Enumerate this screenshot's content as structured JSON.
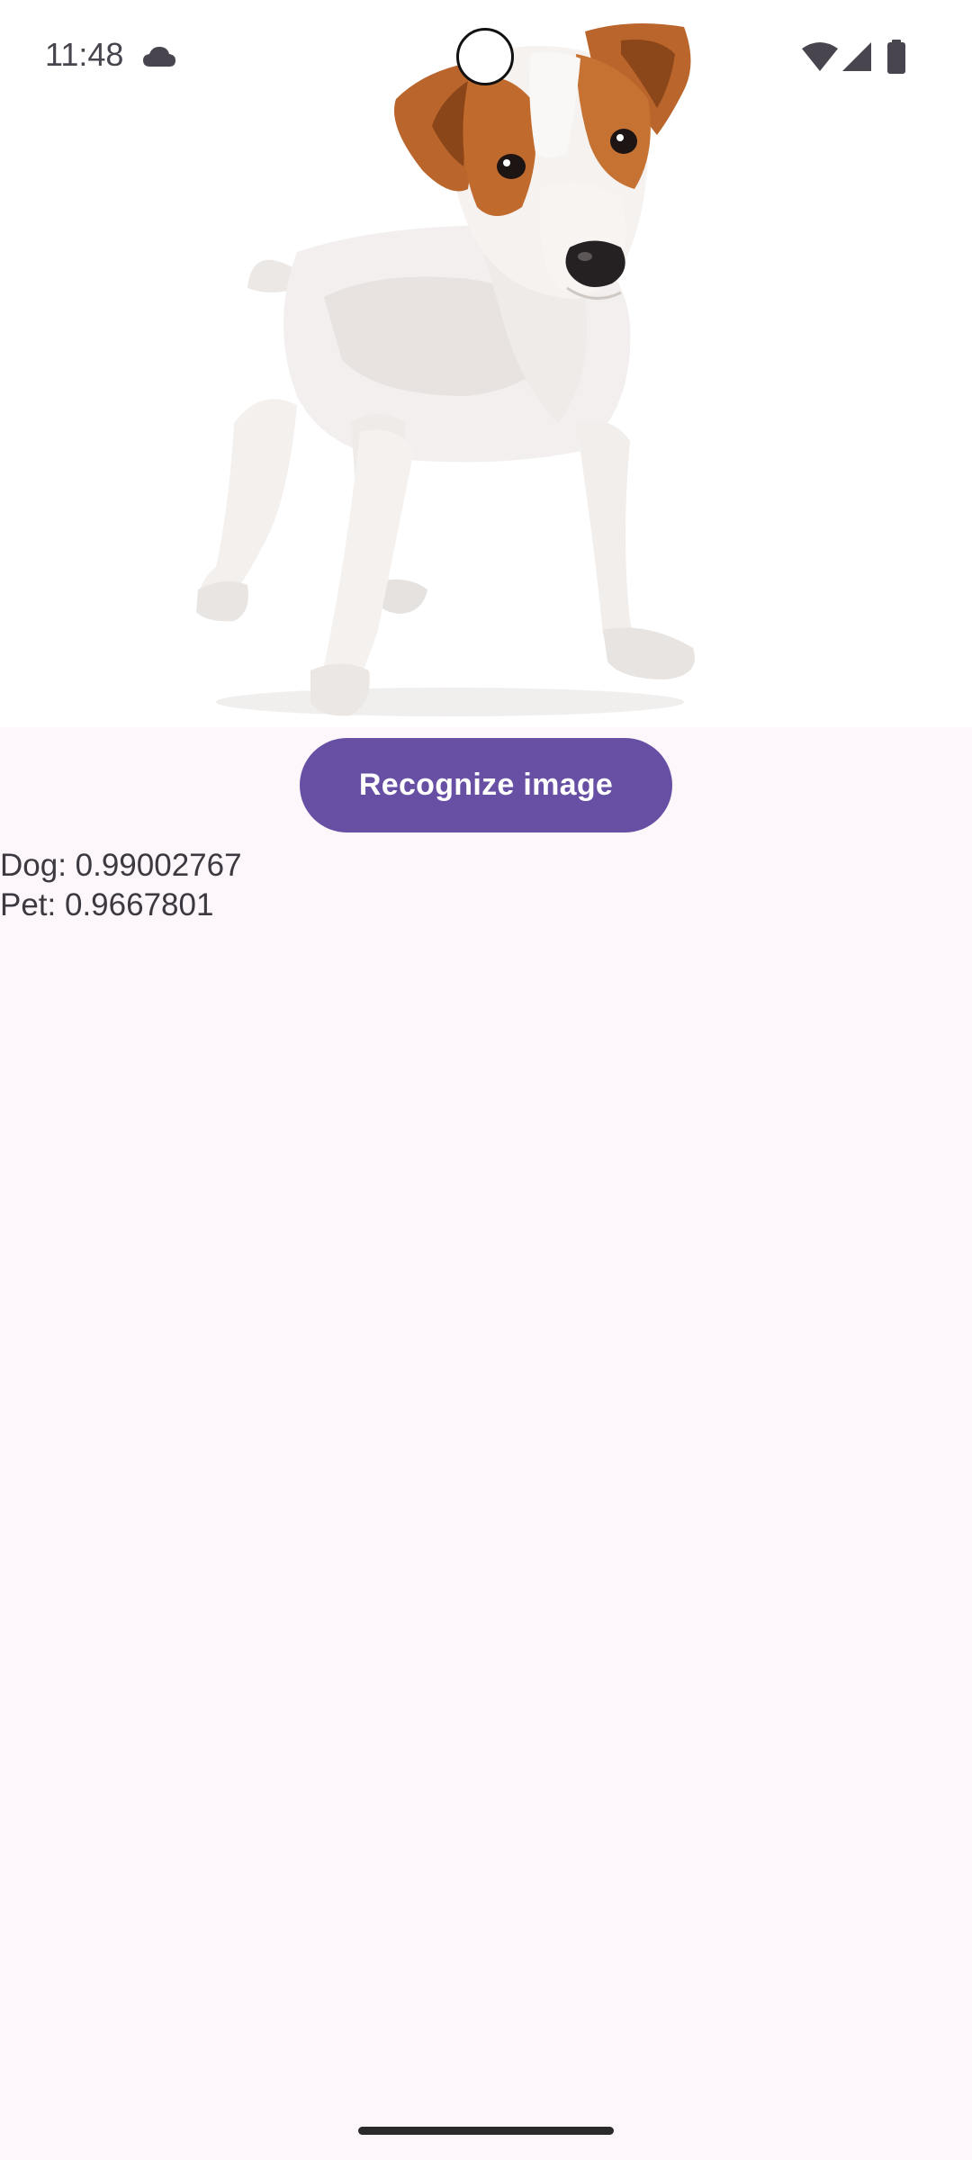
{
  "status_bar": {
    "time": "11:48",
    "icons": [
      "cloud-icon",
      "wifi-icon",
      "signal-icon",
      "battery-icon"
    ]
  },
  "image": {
    "subject": "dog-photo"
  },
  "actions": {
    "recognize_label": "Recognize image"
  },
  "results": [
    "Dog: 0.99002767",
    "Pet: 0.9667801"
  ],
  "colors": {
    "background": "#fdf7fc",
    "button": "#6750a4",
    "button_text": "#ffffff",
    "text": "#3c3a40"
  }
}
